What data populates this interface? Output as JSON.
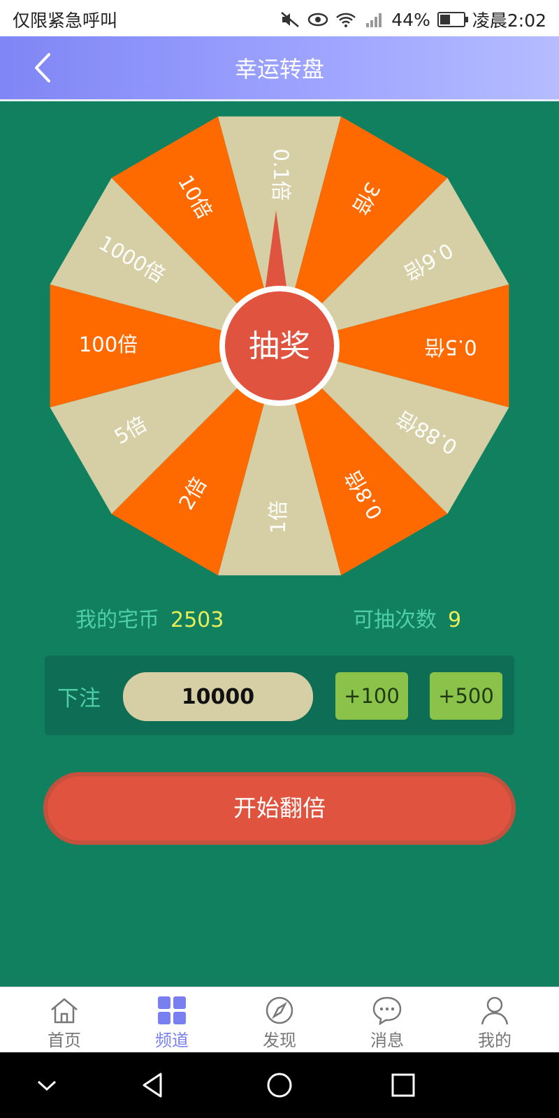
{
  "status_bar": {
    "left_text": "仅限紧急呼叫",
    "battery": "44%",
    "time": "凌晨2:02"
  },
  "header": {
    "title": "幸运转盘"
  },
  "wheel": {
    "center_label": "抽奖",
    "segments": [
      "0.1倍",
      "3倍",
      "0.6倍",
      "0.5倍",
      "0.88倍",
      "0.8倍",
      "1倍",
      "2倍",
      "5倍",
      "100倍",
      "1000倍",
      "10倍"
    ],
    "colors": {
      "beige": "#d6cfa5",
      "orange": "#ff6a00",
      "center": "#e0533e"
    }
  },
  "info": {
    "coins_label": "我的宅币",
    "coins_value": "2503",
    "times_label": "可抽次数",
    "times_value": "9"
  },
  "bet": {
    "label": "下注",
    "value": "10000",
    "add100": "+100",
    "add500": "+500"
  },
  "start_button": "开始翻倍",
  "tabs": [
    {
      "label": "首页",
      "icon": "home-icon",
      "active": false
    },
    {
      "label": "频道",
      "icon": "grid-icon",
      "active": true
    },
    {
      "label": "发现",
      "icon": "compass-icon",
      "active": false
    },
    {
      "label": "消息",
      "icon": "chat-icon",
      "active": false
    },
    {
      "label": "我的",
      "icon": "user-icon",
      "active": false
    }
  ],
  "accent_color": "#7a7ff0",
  "background_color": "#10805f"
}
